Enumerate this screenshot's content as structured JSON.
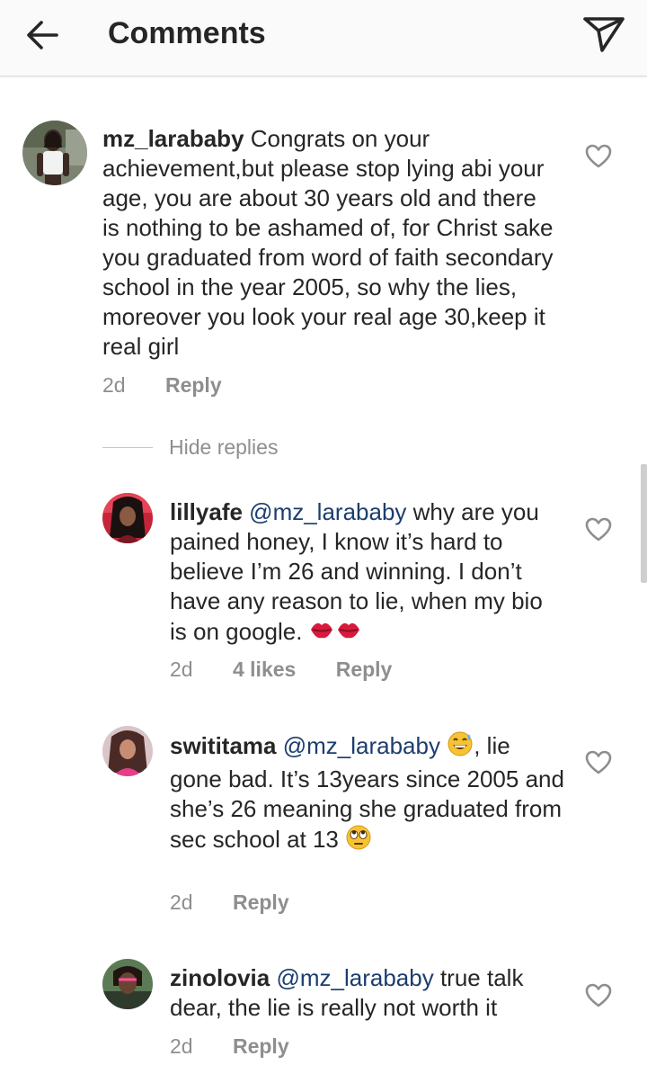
{
  "header": {
    "title": "Comments"
  },
  "main_comment": {
    "username": "mz_larababy",
    "text": " Congrats on your achievement,but please stop lying abi your age, you are about 30 years old and there is nothing to be ashamed of, for Christ sake you graduated from word of faith secondary school in the year 2005, so why the lies, moreover you look your real age 30,keep it real girl",
    "time": "2d",
    "reply_label": "Reply"
  },
  "hide_replies_label": "Hide replies",
  "replies": [
    {
      "username": "lillyafe",
      "mention": "@mz_larababy",
      "text": " why are you pained honey, I know it’s hard to believe I’m 26 and winning. I don’t have any reason to lie, when my bio is on google. ",
      "emoji": "💋💋",
      "time": "2d",
      "likes": "4 likes",
      "reply_label": "Reply"
    },
    {
      "username": "swititama",
      "mention": "@mz_larababy",
      "emoji_mid": "😅",
      "text": ", lie gone bad. It’s 13years since 2005 and she’s 26 meaning she graduated from sec school at 13 ",
      "emoji_end": "🙄",
      "time": "2d",
      "reply_label": "Reply"
    },
    {
      "username": "zinolovia",
      "mention": "@mz_larababy",
      "text": " true talk dear,  the lie is really not worth it",
      "time": "2d",
      "reply_label": "Reply"
    }
  ],
  "colors": {
    "text": "#262626",
    "meta": "#8e8e8e",
    "mention": "#1c3d6e",
    "header_bg": "#fafafa"
  }
}
